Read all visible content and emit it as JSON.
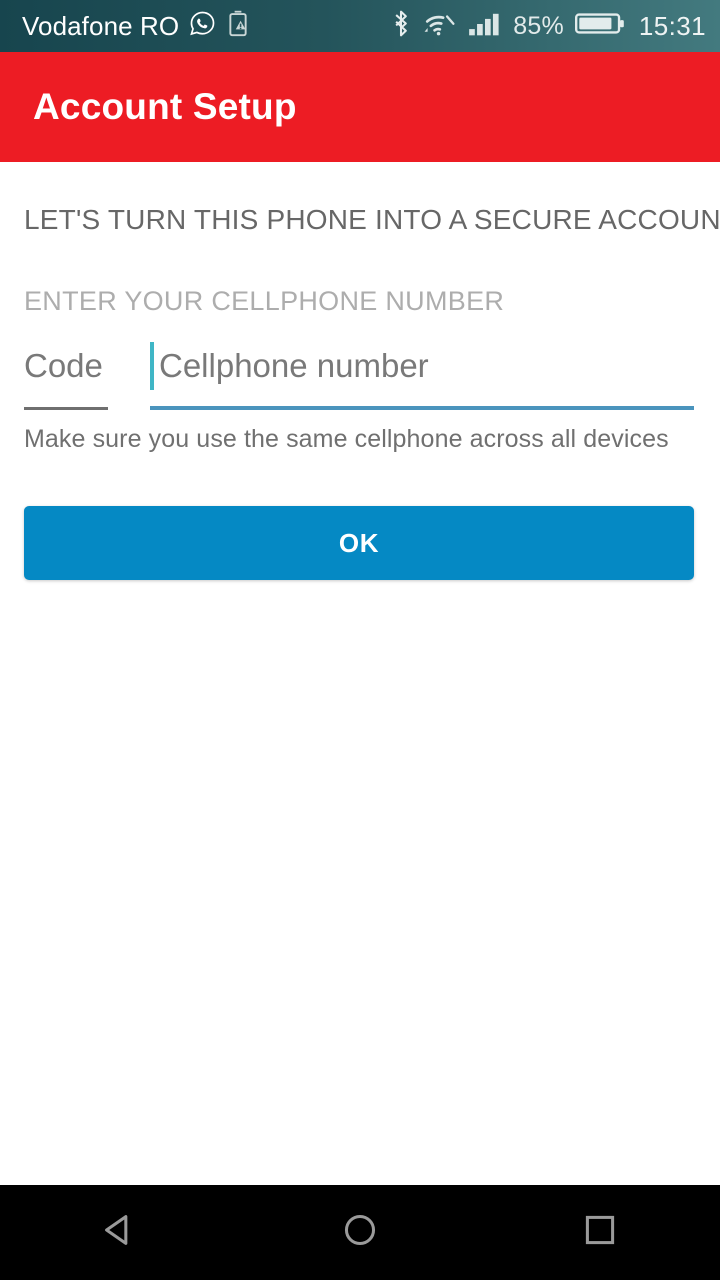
{
  "status_bar": {
    "carrier": "Vodafone RO",
    "battery_percent": "85%",
    "clock": "15:31",
    "icons": [
      "whatsapp-icon",
      "battery-warning-icon",
      "bluetooth-icon",
      "wifi-icon",
      "cellular-signal-icon",
      "battery-icon"
    ],
    "background_color": "#24545b",
    "text_color": "#ffffff"
  },
  "app_bar": {
    "title": "Account Setup",
    "background_color": "#ed1c24",
    "title_color": "#ffffff"
  },
  "content": {
    "headline": "LET'S TURN THIS PHONE INTO A SECURE ACCOUNT",
    "section_label": "ENTER YOUR CELLPHONE NUMBER",
    "code_field": {
      "value": "",
      "placeholder": "Code",
      "underline_color": "#6f6f6f",
      "focused": false
    },
    "phone_field": {
      "value": "",
      "placeholder": "Cellphone number",
      "underline_color": "#4a94bd",
      "caret_color": "#3fb6c6",
      "focused": true
    },
    "helper_text": "Make sure you use the same cellphone across all devices",
    "submit_button": {
      "label": "OK",
      "background_color": "#0589c4",
      "text_color": "#ffffff"
    }
  },
  "nav_bar": {
    "background_color": "#000000",
    "icon_color": "#9a9a9a",
    "buttons": [
      {
        "name": "back",
        "icon": "triangle-left-icon"
      },
      {
        "name": "home",
        "icon": "circle-icon"
      },
      {
        "name": "recents",
        "icon": "square-icon"
      }
    ]
  }
}
